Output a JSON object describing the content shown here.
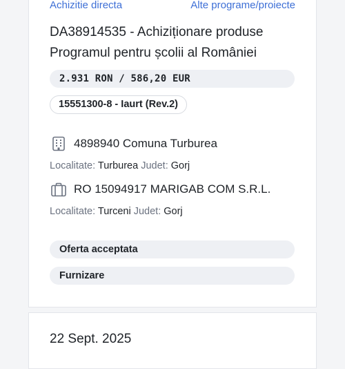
{
  "header": {
    "procedure_type": "Achizitie directa",
    "program_link": "Alte programe/proiecte"
  },
  "tender": {
    "title": "DA38914535 - Achiziționare produse Programul pentru școlii al României",
    "price": "2.931 RON / 586,20 EUR",
    "cpv": "15551300-8 - Iaurt (Rev.2)"
  },
  "authority": {
    "icon": "building-icon",
    "name": "4898940 Comuna Turburea",
    "localitate_label": "Localitate:",
    "localitate": "Turburea",
    "judet_label": "Judet:",
    "judet": "Gorj"
  },
  "supplier": {
    "icon": "briefcase-icon",
    "name": "RO 15094917 MARIGAB COM S.R.L.",
    "localitate_label": "Localitate:",
    "localitate": "Turceni",
    "judet_label": "Judet:",
    "judet": "Gorj"
  },
  "status": {
    "offer": "Oferta acceptata",
    "contract_type": "Furnizare"
  },
  "next_card": {
    "date": "22 Sept. 2025"
  },
  "colors": {
    "link": "#3d6fd6",
    "pill_bg": "#eef0f4",
    "text": "#1f2328",
    "muted": "#6b7280"
  }
}
